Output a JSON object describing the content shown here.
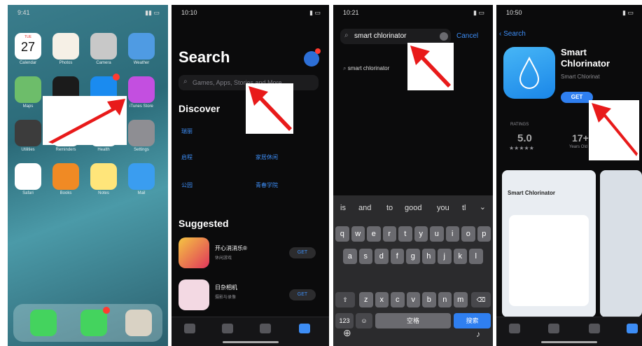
{
  "panel1": {
    "status_time": "9:41",
    "apps": [
      {
        "name": "calendar-app",
        "label": "Calendar",
        "day": "27",
        "weekday": "TUE",
        "color": "#ffffff"
      },
      {
        "name": "photos-app",
        "label": "Photos",
        "color": "#f6f0e6"
      },
      {
        "name": "camera-app",
        "label": "Camera",
        "color": "#c8c8c8"
      },
      {
        "name": "weather-app",
        "label": "Weather",
        "color": "#4f9be3"
      },
      {
        "name": "maps-app",
        "label": "Maps",
        "color": "#6dbd6a"
      },
      {
        "name": "clock-app",
        "label": "Clock",
        "color": "#1b1b1b"
      },
      {
        "name": "app-store-app",
        "label": "App Store",
        "color": "#1a8bf0"
      },
      {
        "name": "itunes-store-app",
        "label": "iTunes Store",
        "color": "#c34fe0"
      },
      {
        "name": "utilities-folder",
        "label": "Utilities",
        "color": "#3c3c3c"
      },
      {
        "name": "reminders-app",
        "label": "Reminders",
        "color": "#ffffff"
      },
      {
        "name": "health-app",
        "label": "Health",
        "color": "#ffffff"
      },
      {
        "name": "settings-app",
        "label": "Settings",
        "color": "#8e8e93"
      },
      {
        "name": "safari-app",
        "label": "Safari",
        "color": "#ffffff"
      },
      {
        "name": "books-app",
        "label": "Books",
        "color": "#f08a24"
      },
      {
        "name": "notes-app",
        "label": "Notes",
        "color": "#ffe57a"
      },
      {
        "name": "mail-app",
        "label": "Mail",
        "color": "#3a9df0"
      }
    ],
    "dock": [
      {
        "name": "phone-app",
        "color": "#44d35e"
      },
      {
        "name": "messages-app",
        "color": "#44d35e"
      },
      {
        "name": "files-app",
        "color": "#d9d2c4"
      }
    ]
  },
  "panel2": {
    "status_time": "10:10",
    "title": "Search",
    "search_placeholder": "Games, Apps, Stories and More",
    "discover_heading": "Discover",
    "discover_items": [
      "瑞丽",
      "灵丽精选",
      "启程",
      "家居休闲",
      "公园",
      "青春学院"
    ],
    "suggested_heading": "Suggested",
    "suggested": [
      {
        "name": "开心消消乐®",
        "sub": "休闲游戏",
        "btn": "GET"
      },
      {
        "name": "日杂相机",
        "sub": "摄影与录像",
        "btn": "GET"
      }
    ]
  },
  "panel3": {
    "status_time": "10:21",
    "query": "smart chlorinator",
    "cancel": "Cancel",
    "suggestion": "smart chlorinator",
    "word_suggestions": [
      "is",
      "and",
      "to",
      "good",
      "you",
      "tl"
    ],
    "row1": [
      "q",
      "w",
      "e",
      "r",
      "t",
      "y",
      "u",
      "i",
      "o",
      "p"
    ],
    "row2": [
      "a",
      "s",
      "d",
      "f",
      "g",
      "h",
      "j",
      "k",
      "l"
    ],
    "row3": [
      "z",
      "x",
      "c",
      "v",
      "b",
      "n",
      "m"
    ],
    "num_key": "123",
    "space": "空格",
    "search_key": "搜索"
  },
  "panel4": {
    "status_time": "10:50",
    "back": "Search",
    "app_title": "Smart Chlorinator",
    "app_sub": "Smart Chlorinat",
    "get": "GET",
    "rating_label": "RATINGS",
    "rating": "5.0",
    "stars": "★★★★★",
    "age": "17+",
    "age_label": "Years Old",
    "shot_title": "Smart Chlorinator"
  }
}
